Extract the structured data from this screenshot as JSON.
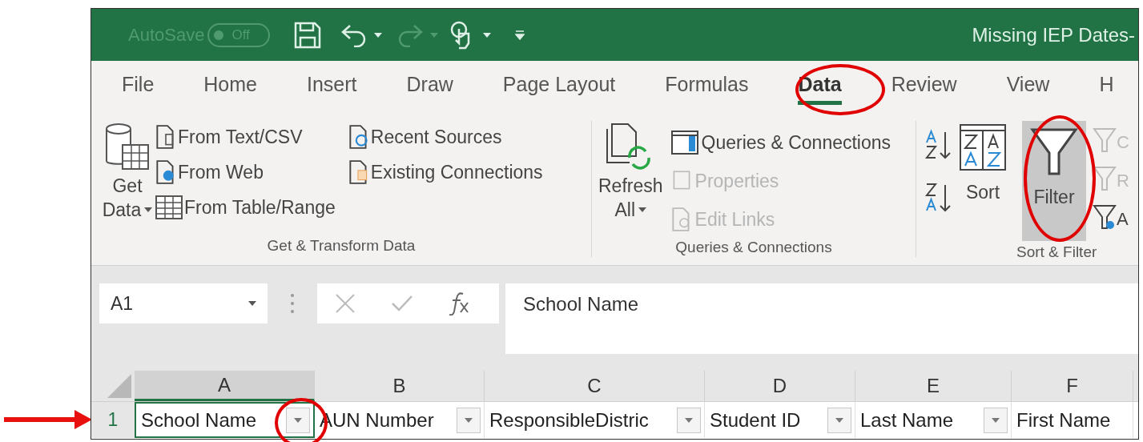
{
  "title_bar": {
    "autosave_label": "AutoSave",
    "autosave_toggle": {
      "label": "Off",
      "on": false
    },
    "document_title": "Missing IEP Dates-"
  },
  "tabs": [
    {
      "label": "File",
      "selected": false
    },
    {
      "label": "Home",
      "selected": false
    },
    {
      "label": "Insert",
      "selected": false
    },
    {
      "label": "Draw",
      "selected": false
    },
    {
      "label": "Page Layout",
      "selected": false
    },
    {
      "label": "Formulas",
      "selected": false
    },
    {
      "label": "Data",
      "selected": true
    },
    {
      "label": "Review",
      "selected": false
    },
    {
      "label": "View",
      "selected": false
    },
    {
      "label": "H",
      "selected": false
    }
  ],
  "get_transform": {
    "label": "Get & Transform Data",
    "get_data": [
      "Get",
      "Data"
    ],
    "items": [
      {
        "kind": "text",
        "text": "From Text/CSV",
        "disabled": false
      },
      {
        "kind": "web",
        "text": "From Web",
        "disabled": false
      },
      {
        "kind": "table",
        "text": "From Table/Range",
        "disabled": false
      },
      {
        "kind": "recent",
        "text": "Recent Sources",
        "disabled": false
      },
      {
        "kind": "existing",
        "text": "Existing Connections",
        "disabled": false
      }
    ]
  },
  "queries": {
    "label": "Queries & Connections",
    "refresh": [
      "Refresh",
      "All"
    ],
    "items": [
      {
        "kind": "queries",
        "text": "Queries & Connections",
        "disabled": false
      },
      {
        "kind": "properties",
        "text": "Properties",
        "disabled": true
      },
      {
        "kind": "links",
        "text": "Edit Links",
        "disabled": true
      }
    ]
  },
  "sort_filter": {
    "label": "Sort & Filter",
    "sort": "Sort",
    "filter": {
      "label": "Filter",
      "on": true
    },
    "cut_labels": [
      "C",
      "R",
      "A"
    ]
  },
  "formula_bar": {
    "name_box": "A1",
    "formula": "School Name"
  },
  "row_number": "1",
  "columns": [
    {
      "letter": "A",
      "header": "School Name",
      "selected": true
    },
    {
      "letter": "B",
      "header": "AUN Number",
      "selected": false
    },
    {
      "letter": "C",
      "header": "ResponsibleDistric",
      "selected": false
    },
    {
      "letter": "D",
      "header": "Student ID",
      "selected": false
    },
    {
      "letter": "E",
      "header": "Last Name",
      "selected": false
    },
    {
      "letter": "F",
      "header": "First Name",
      "selected": false,
      "no_filter_button": true
    }
  ]
}
